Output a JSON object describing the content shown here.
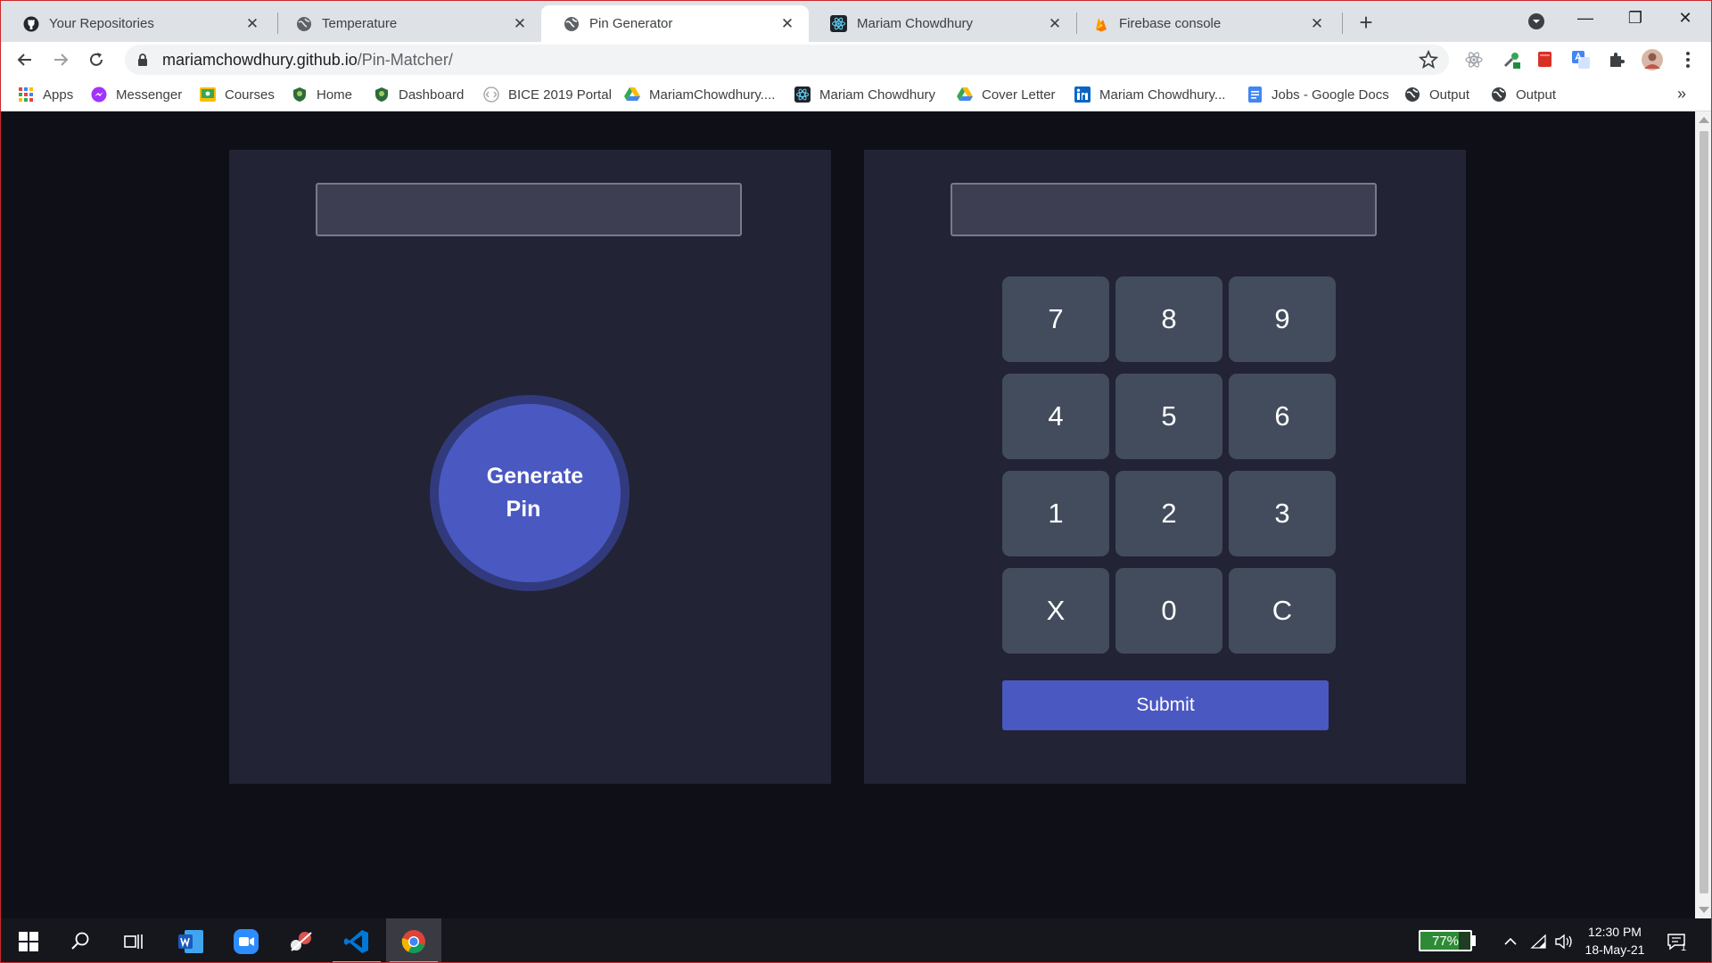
{
  "browser": {
    "tabs": [
      {
        "title": "Your Repositories",
        "icon": "github-icon",
        "active": false
      },
      {
        "title": "Temperature",
        "icon": "globe-icon",
        "active": false
      },
      {
        "title": "Pin Generator",
        "icon": "globe-icon",
        "active": true
      },
      {
        "title": "Mariam Chowdhury",
        "icon": "react-icon",
        "active": false
      },
      {
        "title": "Firebase console",
        "icon": "firebase-icon",
        "active": false
      }
    ],
    "tab_close_glyph": "✕",
    "new_tab_glyph": "+",
    "window_controls": {
      "minimize": "—",
      "restore": "❐",
      "close": "✕"
    },
    "address": {
      "host": "mariamchowdhury.github.io",
      "path": "/Pin-Matcher/"
    },
    "bookmarks": [
      {
        "label": "Apps",
        "icon": "apps-grid-icon"
      },
      {
        "label": "Messenger",
        "icon": "messenger-icon"
      },
      {
        "label": "Courses",
        "icon": "classroom-icon"
      },
      {
        "label": "Home",
        "icon": "shield-icon"
      },
      {
        "label": "Dashboard",
        "icon": "shield-icon"
      },
      {
        "label": "BICE 2019 Portal",
        "icon": "code-icon"
      },
      {
        "label": "MariamChowdhury....",
        "icon": "google-drive-icon"
      },
      {
        "label": "Mariam Chowdhury",
        "icon": "react-icon"
      },
      {
        "label": "Cover Letter",
        "icon": "google-drive-icon"
      },
      {
        "label": "Mariam Chowdhury...",
        "icon": "linkedin-icon"
      },
      {
        "label": "Jobs - Google Docs",
        "icon": "google-docs-icon"
      },
      {
        "label": "Output",
        "icon": "globe-icon"
      },
      {
        "label": "Output",
        "icon": "globe-icon"
      }
    ],
    "bookmarks_more": "»"
  },
  "page": {
    "generator": {
      "display_value": "",
      "button_line1": "Generate",
      "button_line2": "Pin"
    },
    "matcher": {
      "display_value": "",
      "keys": [
        "7",
        "8",
        "9",
        "4",
        "5",
        "6",
        "1",
        "2",
        "3",
        "X",
        "0",
        "C"
      ],
      "submit_label": "Submit"
    },
    "colors": {
      "page_bg": "#0f0f17",
      "panel_bg": "#222335",
      "accent": "#4a58c2",
      "key_bg": "#434c5c"
    }
  },
  "taskbar": {
    "apps": [
      "windows-start-icon",
      "search-icon",
      "task-view-icon",
      "word-icon",
      "zoom-icon",
      "snipping-tool-icon",
      "vscode-icon",
      "chrome-icon"
    ],
    "battery_percent": "77%",
    "battery_level": 0.77,
    "time": "12:30 PM",
    "date": "18-May-21",
    "notification_count": "1"
  }
}
